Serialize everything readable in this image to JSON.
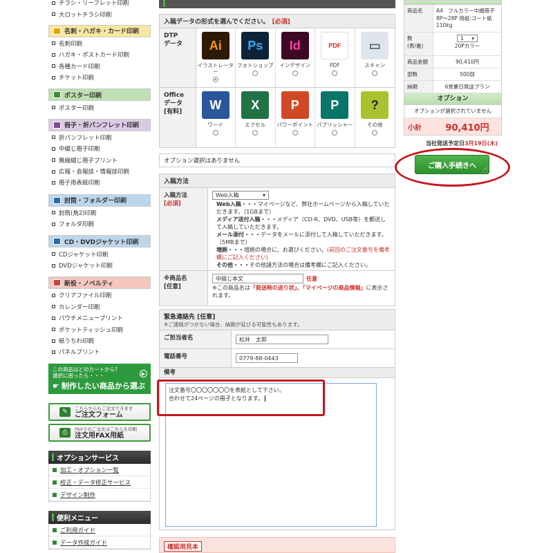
{
  "sidebar": {
    "top_links": [
      "チラシ・リーフレット印刷",
      "大ロットチラシ印刷"
    ],
    "categories": [
      {
        "title": "名刺・ハガキ・カード印刷",
        "color": "y",
        "links": [
          "名刺印刷",
          "ハガキ・ポストカード印刷",
          "各種カード印刷",
          "チケット印刷"
        ]
      },
      {
        "title": "ポスター印刷",
        "color": "g",
        "links": [
          "ポスター印刷"
        ]
      },
      {
        "title": "冊子・折パンフレット印刷",
        "color": "p",
        "links": [
          "折パンフレット印刷",
          "中綴じ冊子印刷",
          "無線綴じ冊子プリント",
          "広報・会報誌・情報誌印刷",
          "冊子用表紙印刷"
        ]
      },
      {
        "title": "封筒・フォルダー印刷",
        "color": "b",
        "links": [
          "封筒(角2)印刷",
          "フォルダ印刷"
        ]
      },
      {
        "title": "CD・DVDジャケット印刷",
        "color": "b",
        "links": [
          "CDジャケット印刷",
          "DVDジャケット印刷"
        ]
      },
      {
        "title": "新役・ノベルティ",
        "color": "r",
        "links": [
          "クリアファイル印刷",
          "カレンダー印刷",
          "パウチメニュープリント",
          "ポケットティッシュ印刷",
          "紙うちわ印刷",
          "パネルプリント"
        ]
      }
    ],
    "find_banner": {
      "line1": "この商品はどのカートから?",
      "line2": "選択に困ったら・・・",
      "main": "制作したい商品から選ぶ"
    },
    "order_form": {
      "small": "こちらからもご注文できます",
      "big": "ご注文フォーム"
    },
    "fax_form": {
      "small": "FAXでのご注文はこちらを印刷",
      "big": "注文用FAX用紙"
    },
    "option_service": {
      "title": "オプションサービス",
      "links": [
        "加工・オプション一覧",
        "校正・データ修正サービス",
        "デザイン制作"
      ]
    },
    "useful_menu": {
      "title": "便利メニュー",
      "links": [
        "ご利用ガイド",
        "データ作成ガイド"
      ]
    }
  },
  "data_format": {
    "title": "入稿データの形式を選んでください。",
    "required": "[必須]",
    "dtp_label": "DTP\nデータ",
    "dtp": [
      {
        "icon": "Ai",
        "label": "イラストレーター",
        "bg": "#2b1a07",
        "fg": "#ff9a00",
        "checked": true
      },
      {
        "icon": "Ps",
        "label": "フォトショップ",
        "bg": "#0d2438",
        "fg": "#31a8ff",
        "checked": false
      },
      {
        "icon": "Id",
        "label": "インデザイン",
        "bg": "#3d0a24",
        "fg": "#ff3ea5",
        "checked": false
      },
      {
        "icon": "PDF",
        "label": "PDF",
        "bg": "#ffffff",
        "fg": "#d8261c",
        "checked": false
      },
      {
        "icon": "▭",
        "label": "スキャン",
        "bg": "#dfe5ea",
        "fg": "#5a6b78",
        "checked": false
      }
    ],
    "office_label": "Office\nデータ\n[有料]",
    "office": [
      {
        "icon": "W",
        "label": "ワード",
        "bg": "#2b579a",
        "fg": "#ffffff"
      },
      {
        "icon": "X",
        "label": "エクセル",
        "bg": "#217346",
        "fg": "#ffffff"
      },
      {
        "icon": "P",
        "label": "パワーポイント",
        "bg": "#d24726",
        "fg": "#ffffff"
      },
      {
        "icon": "P",
        "label": "パブリッシャー",
        "bg": "#077568",
        "fg": "#ffffff"
      },
      {
        "icon": "?",
        "label": "その他",
        "bg": "#a9c22f",
        "fg": "#222222"
      }
    ]
  },
  "option_line": "オプション選択はありません",
  "submission": {
    "title": "入稿方法",
    "method_label": "入稿方法",
    "method_required": "[必須]",
    "method_value": "Web入稿",
    "web_title": "Web入稿・・・",
    "web_text": "マイページなど、弊社ホームページから入稿していただきます。（1GBまで）",
    "media_title": "メディア送付入稿・・・",
    "media_text": "メディア（CD-R、DVD、USB等）を郵送して入稿していただきます。",
    "mail_title": "メール添付・・・",
    "mail_text": "データをメールに添付して入稿していただきます。（5MBまで）",
    "repeat_title": "増刷・・・",
    "repeat_text": "增刷の場合に、お選びください。",
    "repeat_note": "(前回のご注文番号を備考欄にご記入ください)",
    "other_title": "その他・・・",
    "other_text": "その他諸方法の場合は備考欄にご記入ください。",
    "product_label": "※商品名\n[任意]",
    "product_value": "中綴じ本文",
    "product_optional": "任意",
    "product_note_pre": "※この商品名は",
    "product_note_red": "「発送時の送り状」、「マイページの商品情報」",
    "product_note_post": "に表示されます。"
  },
  "contact": {
    "title": "緊急連絡先 [任意]",
    "subtitle": "※ご連絡がつかない場合、納期が延びる可能性もあります。",
    "person_label": "ご担当者名",
    "person_value": "松井　太郎",
    "phone_label": "電話番号",
    "phone_value": "0779-88-0443",
    "notes_label": "備考",
    "notes_line1": "注文番号〇〇〇〇〇〇〇を表紙として下さい。",
    "notes_line2": "合わせて24ページの冊子となります。"
  },
  "confirm_sample": "確認用見本",
  "order_summary": {
    "product_k": "商品名",
    "product_v": "A4　フルカラー中綴冊子　8P～28P 用紙:コート紙110kg",
    "qty_k": "数\n(表/裏)",
    "qty_v": "1",
    "qty_sub": "20Pカラー",
    "price_k": "商品金額",
    "price_v": "90,410円",
    "copies_k": "部数",
    "copies_v": "500部",
    "delivery_k": "納期",
    "delivery_v": "6営業日発送プラン",
    "option_title": "オプション",
    "option_none": "オプションが選択されていません",
    "subtotal_k": "小計",
    "subtotal_v": "90,410円",
    "ship_label": "当社発送予定日",
    "ship_date": "3月19日(木)",
    "purchase_button": "ご購入手続きへ"
  }
}
